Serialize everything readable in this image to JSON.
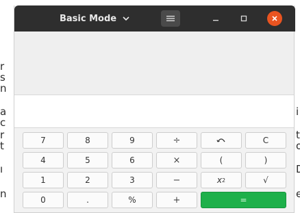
{
  "titlebar": {
    "mode_label": "Basic Mode",
    "menu_icon": "hamburger-icon",
    "minimize_icon": "minimize-icon",
    "maximize_icon": "maximize-icon",
    "close_icon": "close-icon",
    "close_color": "#e95420"
  },
  "display": {
    "value": ""
  },
  "keys": {
    "k7": "7",
    "k8": "8",
    "k9": "9",
    "divide": "÷",
    "undo_icon": "undo-icon",
    "clear": "C",
    "k4": "4",
    "k5": "5",
    "k6": "6",
    "multiply": "×",
    "lparen": "(",
    "rparen": ")",
    "k1": "1",
    "k2": "2",
    "k3": "3",
    "subtract": "−",
    "square_base": "x",
    "square_exp": "2",
    "sqrt": "√",
    "k0": "0",
    "decimal": ".",
    "percent": "%",
    "add": "+",
    "equals": "="
  },
  "colors": {
    "titlebar": "#2e2e2e",
    "equals": "#1eb04a"
  },
  "background_text": {
    "left": [
      "r",
      "s",
      "n",
      "a",
      "c",
      "r",
      "t",
      "ı",
      "n"
    ],
    "right": [
      "i",
      "t",
      "o",
      "D",
      "e"
    ]
  }
}
